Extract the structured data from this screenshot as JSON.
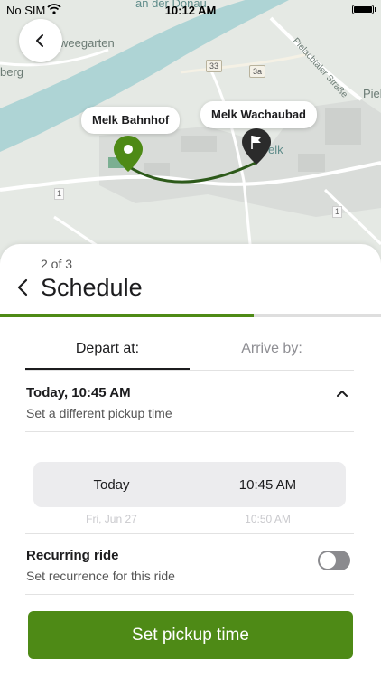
{
  "status_bar": {
    "carrier": "No SIM",
    "time": "10:12 AM",
    "wifi_icon": "wifi-icon",
    "battery_icon": "battery-icon"
  },
  "map": {
    "labels": {
      "an_der_donau": "an der Donau",
      "weegarten": "weegarten",
      "berg": "berg",
      "pielach_road": "Pielachtaler Straße",
      "piel": "Piel",
      "melk": "elk"
    },
    "road_numbers": {
      "r33": "33",
      "r3a": "3a",
      "r1_a": "1",
      "r1_b": "1"
    },
    "origin": {
      "label": "Melk Bahnhof",
      "icon": "pin-icon"
    },
    "destination": {
      "label": "Melk Wachaubad",
      "icon": "flag-icon"
    },
    "colors": {
      "water": "#aed4d5",
      "route": "#2d5a1a",
      "origin_pin": "#4e8a16",
      "destination_pin": "#2b2b2b"
    }
  },
  "back_button": {
    "icon": "chevron-left-icon"
  },
  "sheet": {
    "step": "2 of 3",
    "title": "Schedule",
    "progress_fraction": 0.667,
    "tabs": [
      {
        "label": "Depart at:",
        "active": true
      },
      {
        "label": "Arrive by:",
        "active": false
      }
    ],
    "pickup": {
      "main": "Today, 10:45 AM",
      "sub": "Set a different pickup time",
      "icon": "chevron-up-icon"
    },
    "picker": {
      "day": "Today",
      "time": "10:45 AM",
      "next_day": "Fri, Jun 27",
      "next_time": "10:50 AM"
    },
    "recurring": {
      "title": "Recurring ride",
      "sub": "Set recurrence for this ride",
      "enabled": false
    },
    "cta": "Set pickup time"
  },
  "colors": {
    "accent": "#4e8a16",
    "toggle_off": "#8a8a8e"
  }
}
